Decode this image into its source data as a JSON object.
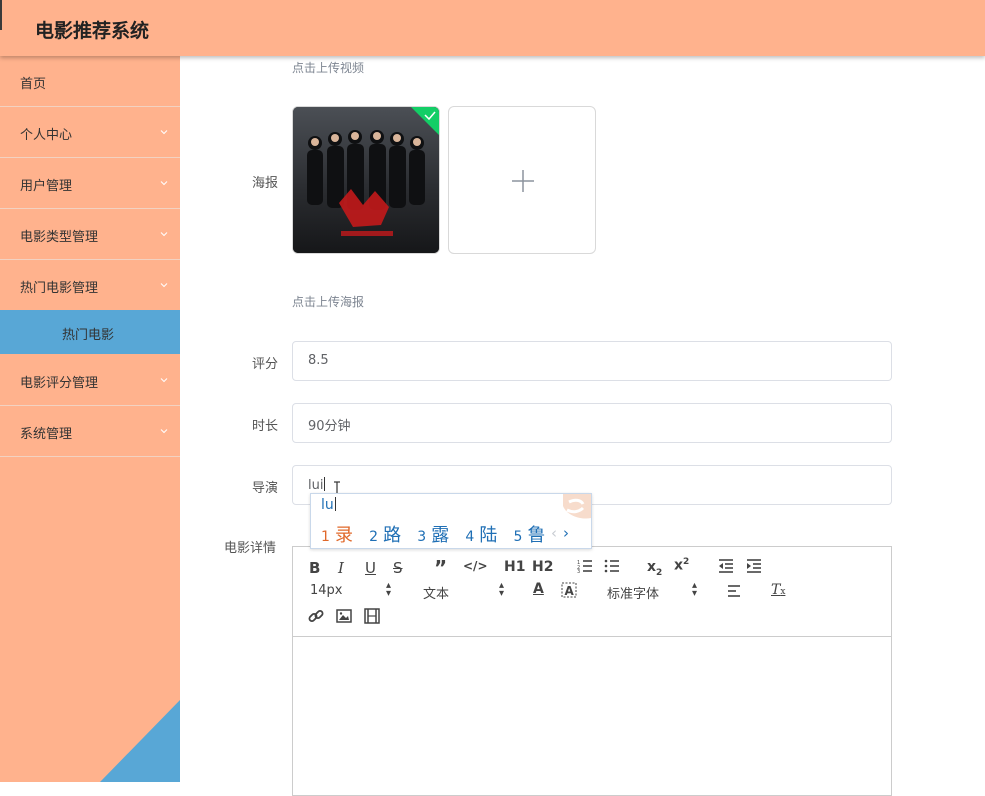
{
  "app": {
    "title": "电影推荐系统"
  },
  "sidebar": {
    "items": [
      {
        "label": "首页"
      },
      {
        "label": "个人中心"
      },
      {
        "label": "用户管理"
      },
      {
        "label": "电影类型管理"
      },
      {
        "label": "热门电影管理"
      },
      {
        "label": "热门电影"
      },
      {
        "label": "电影评分管理"
      },
      {
        "label": "系统管理"
      }
    ]
  },
  "form": {
    "video_hint": "点击上传视频",
    "poster_label": "海报",
    "poster_hint": "点击上传海报",
    "rating_label": "评分",
    "rating_value": "8.5",
    "duration_label": "时长",
    "duration_value": "90分钟",
    "director_label": "导演",
    "director_value": "lui",
    "details_label": "电影详情"
  },
  "ime": {
    "composition": "lu",
    "candidates": [
      {
        "num": "1",
        "char": "录"
      },
      {
        "num": "2",
        "char": "路"
      },
      {
        "num": "3",
        "char": "露"
      },
      {
        "num": "4",
        "char": "陆"
      },
      {
        "num": "5",
        "char": "鲁"
      }
    ],
    "prev": "‹",
    "next": "›"
  },
  "editor": {
    "font_size": "14px",
    "block_format": "文本",
    "font_family": "标准字体",
    "h1": "H1",
    "h2": "H2"
  },
  "colors": {
    "header_bg": "#ffb28d",
    "sidebar_bg": "#ffb28d",
    "active_item_bg": "#58a7d6",
    "success_badge": "#13ce66"
  }
}
